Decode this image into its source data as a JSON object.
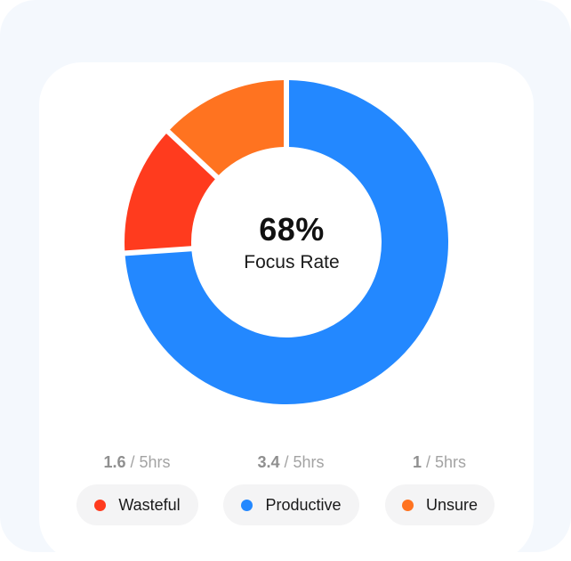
{
  "chart_data": {
    "type": "pie",
    "variant": "donut",
    "center": {
      "value": "68%",
      "label": "Focus Rate"
    },
    "slices": [
      {
        "name": "Productive",
        "value": 3.4,
        "color": "#2388ff"
      },
      {
        "name": "Wasteful",
        "value": 0.6,
        "color": "#ff3b1e"
      },
      {
        "name": "Unsure",
        "value": 0.6,
        "color": "#ff7320"
      }
    ],
    "legend": [
      {
        "value": "1.6",
        "total": "5hrs",
        "name": "Wasteful",
        "color": "#ff3b1e"
      },
      {
        "value": "3.4",
        "total": "5hrs",
        "name": "Productive",
        "color": "#2388ff"
      },
      {
        "value": "1",
        "total": "5hrs",
        "name": "Unsure",
        "color": "#ff7320"
      }
    ]
  }
}
